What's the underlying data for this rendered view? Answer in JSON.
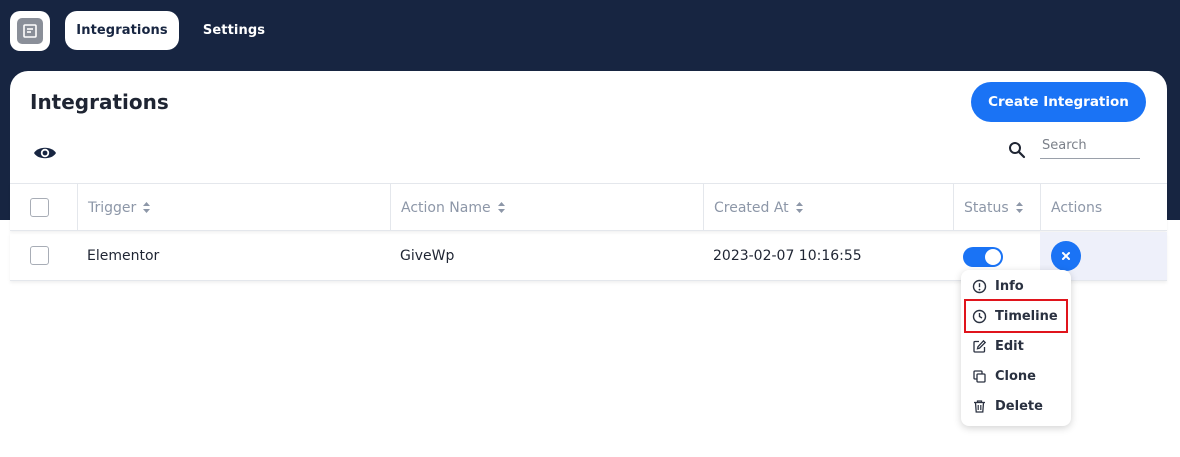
{
  "nav": {
    "logo_icon": "app-logo-icon",
    "tabs": [
      {
        "label": "Integrations",
        "active": true
      },
      {
        "label": "Settings",
        "active": false
      }
    ]
  },
  "page": {
    "title": "Integrations",
    "create_button": "Create Integration",
    "search_placeholder": "Search"
  },
  "table": {
    "columns": [
      "Trigger",
      "Action Name",
      "Created At",
      "Status",
      "Actions"
    ],
    "rows": [
      {
        "trigger": "Elementor",
        "action_name": "GiveWp",
        "created_at": "2023-02-07 10:16:55",
        "status_on": true
      }
    ]
  },
  "actions_menu": {
    "items": [
      {
        "label": "Info",
        "icon": "info-icon"
      },
      {
        "label": "Timeline",
        "icon": "clock-icon",
        "highlighted": true
      },
      {
        "label": "Edit",
        "icon": "edit-icon"
      },
      {
        "label": "Clone",
        "icon": "clone-icon"
      },
      {
        "label": "Delete",
        "icon": "trash-icon"
      }
    ]
  },
  "colors": {
    "topbar": "#172541",
    "accent": "#1a73f5",
    "highlight_outline": "#e0141c"
  }
}
